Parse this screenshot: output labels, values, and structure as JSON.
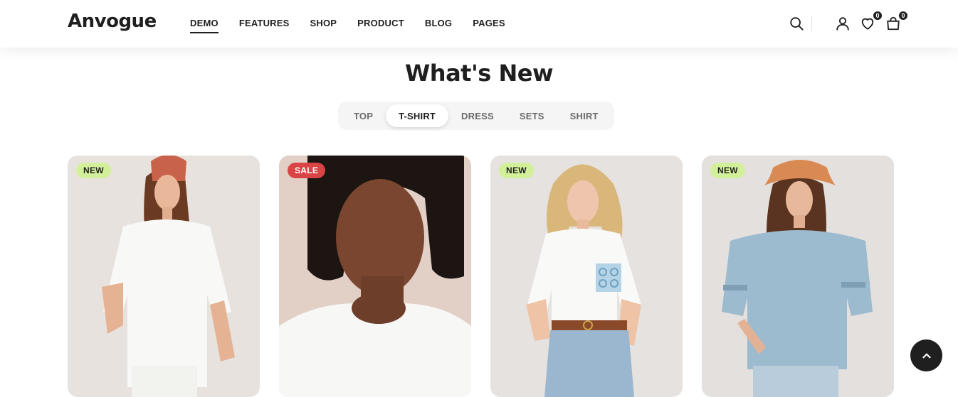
{
  "brand": {
    "logo": "Anvogue"
  },
  "nav": {
    "items": [
      "DEMO",
      "FEATURES",
      "SHOP",
      "PRODUCT",
      "BLOG",
      "PAGES"
    ],
    "active": "DEMO"
  },
  "header_icons": {
    "search": "search-icon",
    "account": "user-icon",
    "wishlist": {
      "icon": "heart-icon",
      "count": "0"
    },
    "cart": {
      "icon": "shopping-bag-icon",
      "count": "0"
    }
  },
  "section": {
    "title": "What's New",
    "tabs": [
      "TOP",
      "T-SHIRT",
      "DRESS",
      "SETS",
      "SHIRT"
    ],
    "active_tab": "T-SHIRT"
  },
  "products": [
    {
      "tag": "NEW",
      "tag_type": "new"
    },
    {
      "tag": "SALE",
      "tag_type": "sale"
    },
    {
      "tag": "NEW",
      "tag_type": "new"
    },
    {
      "tag": "NEW",
      "tag_type": "new"
    }
  ],
  "colors": {
    "text": "#1f1f1f",
    "new_tag": "#d2ef9a",
    "sale_tag": "#db4444",
    "back_to_top": "#1f1f1f"
  },
  "back_to_top": {
    "icon": "chevron-up-icon"
  }
}
